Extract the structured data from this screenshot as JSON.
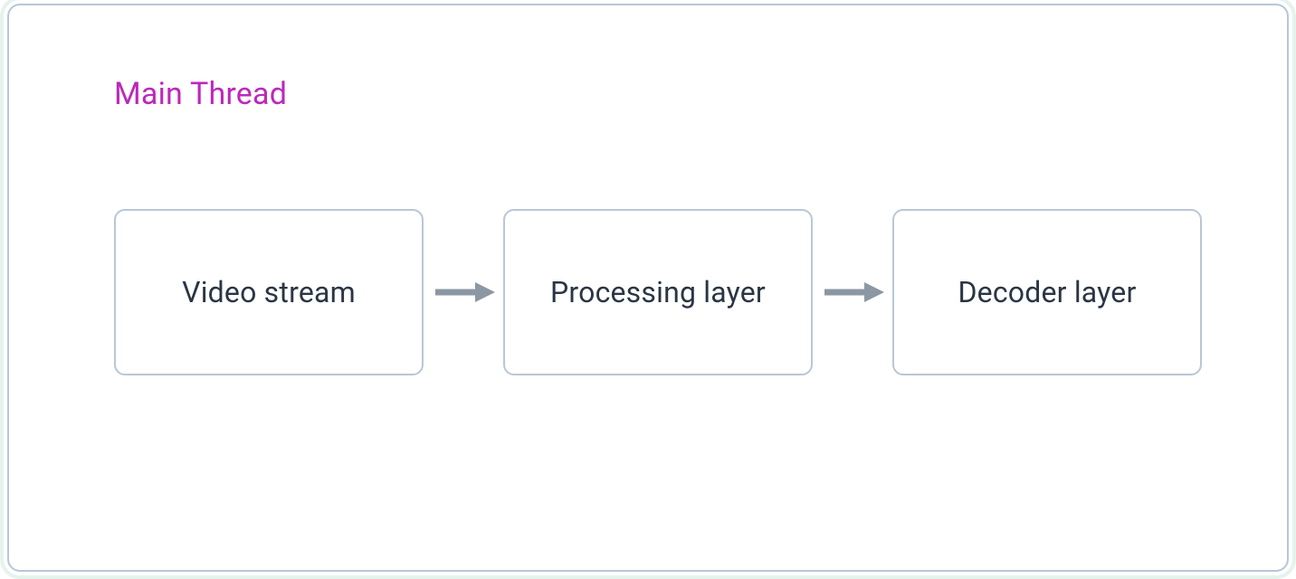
{
  "diagram": {
    "title": "Main Thread",
    "nodes": [
      {
        "label": "Video stream"
      },
      {
        "label": "Processing layer"
      },
      {
        "label": "Decoder layer"
      }
    ]
  },
  "colors": {
    "title": "#bb29bb",
    "node_border": "#b8c7d6",
    "node_text": "#2a3544",
    "arrow": "#8b97a3"
  }
}
